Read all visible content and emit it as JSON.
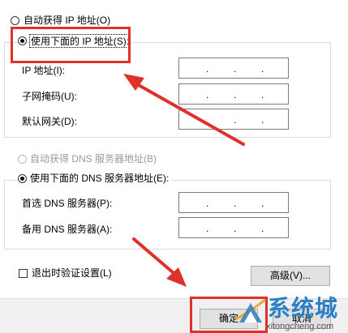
{
  "ip_section": {
    "auto_label": "自动获得 IP 地址(O)",
    "manual_label": "使用下面的 IP 地址(S):",
    "ip_label": "IP 地址(I):",
    "subnet_label": "子网掩码(U):",
    "gateway_label": "默认网关(D):"
  },
  "dns_section": {
    "auto_label": "自动获得 DNS 服务器地址(B)",
    "manual_label": "使用下面的 DNS 服务器地址(E):",
    "preferred_label": "首选 DNS 服务器(P):",
    "alternate_label": "备用 DNS 服务器(A):"
  },
  "ip_separator": ".",
  "validate_label": "退出时验证设置(L)",
  "advanced_label": "高级(V)...",
  "ok_label": "确定",
  "cancel_label": "取消",
  "watermark": {
    "title": "系统城",
    "url": "xitongcheng.com"
  },
  "colors": {
    "annotation_red": "#e0302a",
    "watermark_blue": "#2b7fc4"
  }
}
